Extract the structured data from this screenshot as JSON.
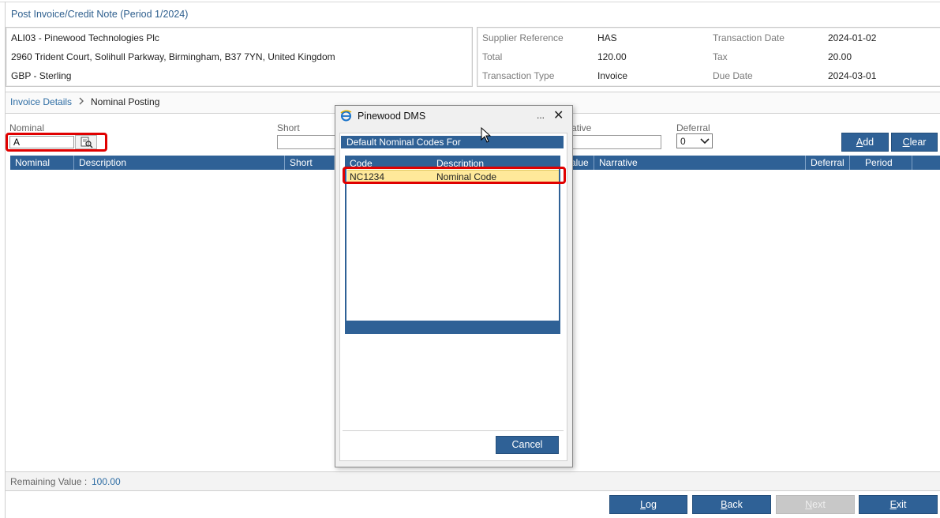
{
  "page": {
    "title": "Post Invoice/Credit Note (Period 1/2024)"
  },
  "supplier": {
    "name": "ALI03 - Pinewood Technologies Plc",
    "address": "2960 Trident Court, Solihull Parkway, Birmingham, B37 7YN, United Kingdom",
    "currency": "GBP - Sterling"
  },
  "invoice_info": {
    "supplier_ref_label": "Supplier Reference",
    "supplier_ref_value": "HAS",
    "total_label": "Total",
    "total_value": "120.00",
    "tx_type_label": "Transaction Type",
    "tx_type_value": "Invoice",
    "tx_date_label": "Transaction Date",
    "tx_date_value": "2024-01-02",
    "tax_label": "Tax",
    "tax_value": "20.00",
    "due_date_label": "Due Date",
    "due_date_value": "2024-03-01"
  },
  "breadcrumb": {
    "item1": "Invoice Details",
    "sep": ">",
    "item2": "Nominal Posting"
  },
  "form": {
    "nominal_label": "Nominal",
    "nominal_value": "A",
    "short_label": "Short",
    "narrative_label_partial": "ative",
    "deferral_label": "Deferral",
    "deferral_value": "0",
    "add_label_key": "A",
    "add_label_rest": "dd",
    "clear_label_key": "C",
    "clear_label_rest": "lear"
  },
  "grid": {
    "columns": [
      "Nominal",
      "Description",
      "Short",
      "alue",
      "Narrative",
      "Deferral",
      "Period"
    ]
  },
  "remaining": {
    "label": "Remaining Value :",
    "value": "100.00"
  },
  "footer": {
    "log_key": "L",
    "log_rest": "og",
    "back_key": "B",
    "back_rest": "ack",
    "next_key": "N",
    "next_rest": "ext",
    "exit_key": "E",
    "exit_rest": "xit"
  },
  "dialog": {
    "title": "Pinewood DMS",
    "dots": "...",
    "close": "✕",
    "subtitle": "Default Nominal Codes For",
    "col_code": "Code",
    "col_description": "Description",
    "rows": [
      {
        "code": "NC1234",
        "description": "Nominal Code"
      }
    ],
    "cancel_label": "Cancel"
  },
  "colors": {
    "accent": "#2f6196",
    "highlight_row": "#ffe99a",
    "annotation_red": "#e00000"
  }
}
